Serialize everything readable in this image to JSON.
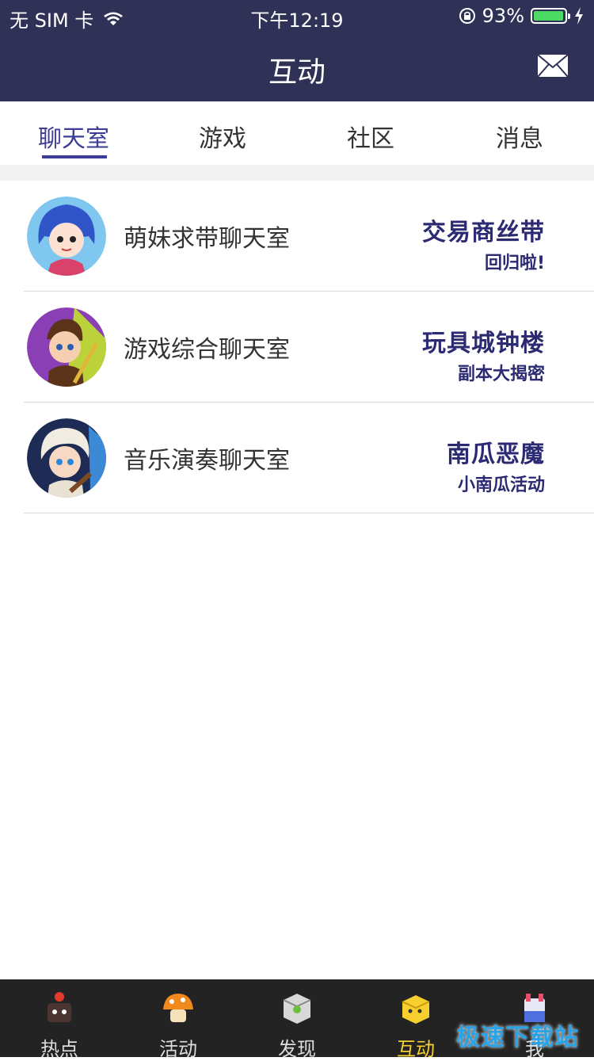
{
  "status": {
    "carrier": "无 SIM 卡",
    "time": "下午12:19",
    "battery": "93%",
    "battery_level": 0.93
  },
  "header": {
    "title": "互动"
  },
  "tabs": [
    {
      "label": "聊天室",
      "active": true
    },
    {
      "label": "游戏",
      "active": false
    },
    {
      "label": "社区",
      "active": false
    },
    {
      "label": "消息",
      "active": false
    }
  ],
  "rooms": [
    {
      "name": "萌妹求带聊天室",
      "promo_line1": "交易商丝带",
      "promo_line2": "回归啦!"
    },
    {
      "name": "游戏综合聊天室",
      "promo_line1": "玩具城钟楼",
      "promo_line2": "副本大揭密"
    },
    {
      "name": "音乐演奏聊天室",
      "promo_line1": "南瓜恶魔",
      "promo_line2": "小南瓜活动"
    }
  ],
  "bottom_nav": [
    {
      "label": "热点",
      "icon": "hotspot-icon"
    },
    {
      "label": "活动",
      "icon": "mushroom-icon"
    },
    {
      "label": "发现",
      "icon": "discover-box-icon"
    },
    {
      "label": "互动",
      "icon": "interact-icon",
      "active": true
    },
    {
      "label": "我",
      "icon": "me-icon"
    }
  ],
  "watermark": "极速下载站",
  "colors": {
    "header_bg": "#2f3156",
    "accent": "#3d3d97",
    "promo_text": "#2b2a72",
    "nav_active": "#f7cf2f"
  }
}
